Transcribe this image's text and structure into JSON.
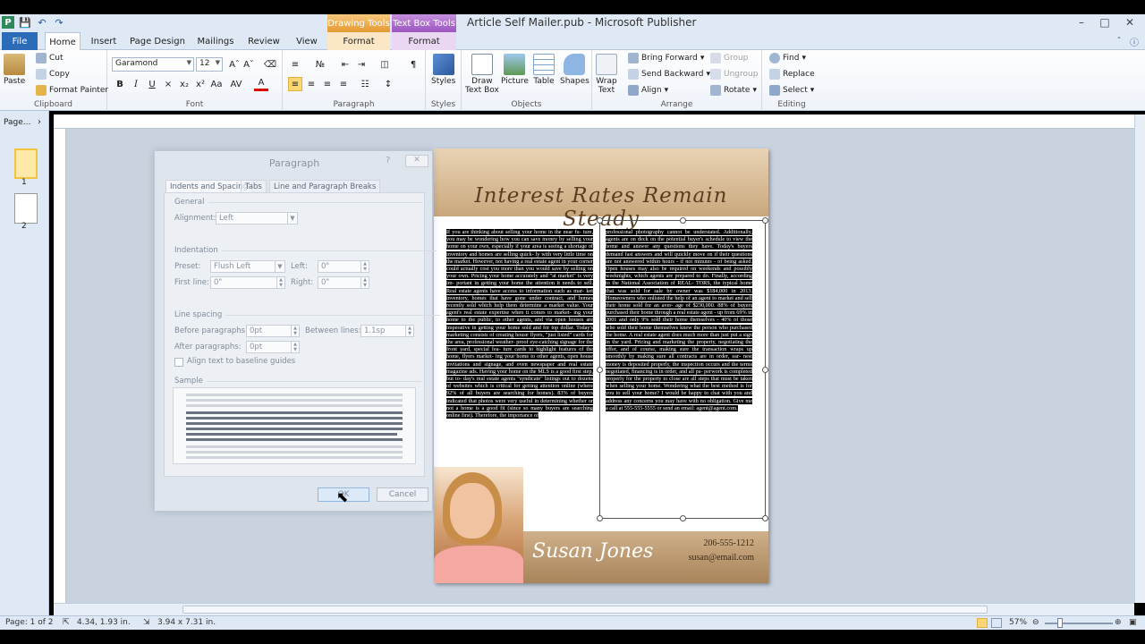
{
  "window": {
    "title": "Article Self Mailer.pub - Microsoft Publisher",
    "app_icon": "P",
    "context_drawing": "Drawing Tools",
    "context_textbox": "Text Box Tools"
  },
  "tabs": {
    "file": "File",
    "home": "Home",
    "insert": "Insert",
    "page_design": "Page Design",
    "mailings": "Mailings",
    "review": "Review",
    "view": "View",
    "format_drawing": "Format",
    "format_textbox": "Format"
  },
  "ribbon": {
    "clipboard": {
      "label": "Clipboard",
      "paste": "Paste",
      "cut": "Cut",
      "copy": "Copy",
      "format_painter": "Format Painter"
    },
    "font": {
      "label": "Font",
      "family": "Garamond",
      "size": "12"
    },
    "paragraph": {
      "label": "Paragraph"
    },
    "styles": {
      "label": "Styles",
      "styles": "Styles"
    },
    "objects": {
      "label": "Objects",
      "draw_text_box_1": "Draw",
      "draw_text_box_2": "Text Box",
      "picture": "Picture",
      "table": "Table",
      "shapes": "Shapes"
    },
    "arrange": {
      "label": "Arrange",
      "wrap_text_1": "Wrap",
      "wrap_text_2": "Text",
      "bring_forward": "Bring Forward",
      "send_backward": "Send Backward",
      "align": "Align",
      "group": "Group",
      "ungroup": "Ungroup",
      "rotate": "Rotate"
    },
    "editing": {
      "label": "Editing",
      "find": "Find",
      "replace": "Replace",
      "select": "Select"
    }
  },
  "nav": {
    "header": "Page...",
    "pages": [
      "1",
      "2"
    ]
  },
  "publication": {
    "headline": "Interest Rates Remain Steady",
    "col1_text": "If you are thinking about selling your home in the near fu- ture, you may be wondering how you can save money by selling your home on your own, especially if your area is seeing a shortage of inventory and homes are selling quick- ly with very little time on the market. However, not having a real estate agent in your corner could actually cost you more than you would save by selling on your own. Pricing your home accurately and \"at market\" is very im- portant in getting your home the attention it needs to sell. Real estate agents have access to information such as mar- ket inventory, homes that have gone under contract, and homes recently sold which help them determine a market value. Your agent's real estate expertise when it comes to market- ing your home to the public, to other agents, and via open houses are imperative in getting your home sold and for top dollar. Today's marketing consists of creating house flyers, \"just listed\" cards for the area, professional weather- proof eye-catching signage for the front yard, special fea- ture cards to highlight features of the home, flyers market- ing your home to other agents, open house invitations and signage, and even newspaper and real estate magazine ads. Having your home on the MLS is a good first step, but to- day's real estate agents \"syndicate\" listings out to dozens of websites which is critical for getting attention online (where 92% of all buyers are searching for homes). 83% of buyers indicated that photos were very useful in determining whether or not a home is a good fit (since so many buyers are searching online first). Therefore, the importance of",
    "col2_text": "professional photography cannot be understated. Additionally, agents are on deck on the potential buyer's schedule to view the home and answer any questions they have. Today's buyers demand fast answers and will quickly move on if their questions are not answered within hours - if not minutes - of being asked. Open houses may also be required on weekends and possibly weeknights, which agents are prepared to do. Finally, according to the National Association of REAL- TORS, the typical home that was sold for sale by owner was $184,000 in 2013. Homeowners who enlisted the help of an agent to market and sell their home sold for an aver- age of $230,000. 88% of buyers purchased their home through a real estate agent - up from 69% in 2001 and only 9% sold their home themselves - 40% of those who sold their home themselves knew the person who purchased the home. A real estate agent does much more than just put a sign in the yard. Pricing and marketing the property, negotiating the offer, and of course, making sure the transaction wraps up smoothly by making sure all contracts are in order, ear- nest money is deposited properly, the inspection occurs and the terms negotiated, financing is in order, and all pa- perwork is completed properly for the property to close are all steps that must be taken when selling your home. Wondering what the best method is for you to sell your home? I would be happy to chat with you and address any concerns you may have with no obligation. Give me a call at 555-555-5555 or send an email: agent@agent.com.",
    "agent_name": "Susan Jones",
    "phone": "206-555-1212",
    "email": "susan@email.com"
  },
  "dialog": {
    "title": "Paragraph",
    "help": "?",
    "tabs": [
      "Indents and Spacing",
      "Tabs",
      "Line and Paragraph Breaks"
    ],
    "general": "General",
    "alignment_label": "Alignment:",
    "alignment_value": "Left",
    "indentation": "Indentation",
    "preset_label": "Preset:",
    "preset_value": "Flush Left",
    "left_label": "Left:",
    "left_value": "0\"",
    "first_line_label": "First line:",
    "first_line_value": "0\"",
    "right_label": "Right:",
    "right_value": "0\"",
    "line_spacing": "Line spacing",
    "before_label": "Before paragraphs:",
    "before_value": "0pt",
    "between_label": "Between lines:",
    "between_value": "1.1sp",
    "after_label": "After paragraphs:",
    "after_value": "0pt",
    "baseline_label": "Align text to baseline guides",
    "sample_label": "Sample",
    "ok": "OK",
    "cancel": "Cancel"
  },
  "status": {
    "page": "Page: 1 of 2",
    "position": "4.34, 1.93 in.",
    "size": "3.94 x 7.31 in.",
    "zoom": "57%"
  },
  "colors": {
    "file_tab": "#2b6bb8",
    "drawing_tools": "#e59a30",
    "text_box_tools": "#9b55c0",
    "footer": "#a8845a"
  }
}
